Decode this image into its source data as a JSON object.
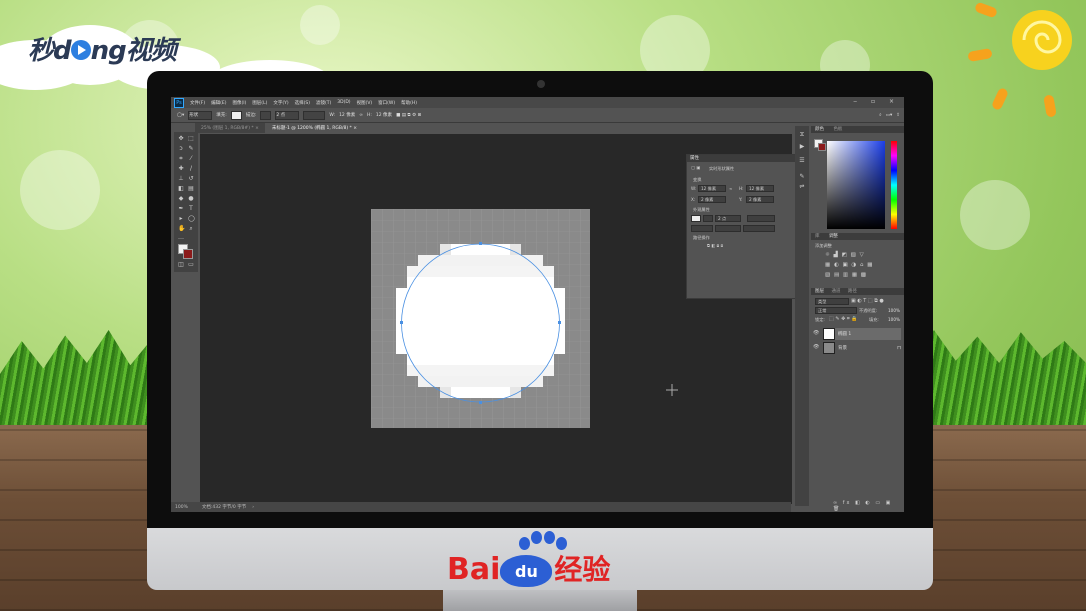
{
  "watermark": {
    "logo_prefix": "秒d",
    "logo_suffix": "ng视频"
  },
  "brand": {
    "baidu_left": "Bai",
    "baidu_du": "du",
    "baidu_right": "经验"
  },
  "photoshop": {
    "app_icon": "Ps",
    "menu": [
      "文件(F)",
      "编辑(E)",
      "图像(I)",
      "图层(L)",
      "文字(Y)",
      "选择(S)",
      "滤镜(T)",
      "3D(D)",
      "视图(V)",
      "窗口(W)",
      "帮助(H)"
    ],
    "window_controls": "‒ ▫ ×",
    "options_bar": {
      "tool_label": "形状",
      "fill_label": "填充:",
      "stroke_label": "描边:",
      "stroke_size": "2 点",
      "w_label": "W:",
      "w_value": "12 像素",
      "h_label": "H:",
      "h_value": "12 像素"
    },
    "tabs": [
      {
        "label": "25% (图层 1, RGB/8#) *",
        "active": false
      },
      {
        "label": "未标题-1 @ 1200% (椭圆 1, RGB/8) *",
        "active": true
      }
    ],
    "status": {
      "zoom": "100%",
      "doc_info": "文档:432 字节/0 字节"
    },
    "properties_panel": {
      "tab": "属性",
      "title": "实时形状属性",
      "section_transform": "变换",
      "w_label": "W:",
      "w_value": "12 像素",
      "h_label": "H:",
      "h_value": "12 像素",
      "x_label": "X:",
      "x_value": "2 像素",
      "y_label": "Y:",
      "y_value": "2 像素",
      "section_appearance": "外观属性",
      "stroke_value": "2 点",
      "section_path_ops": "路径操作"
    },
    "color_panel": {
      "tabs": [
        "颜色",
        "色板"
      ]
    },
    "adjust_panel": {
      "tabs": [
        "库",
        "调整"
      ],
      "title": "添加调整"
    },
    "layers_panel": {
      "tabs": [
        "图层",
        "通道",
        "路径"
      ],
      "filter": "类型",
      "blend_mode": "正常",
      "opacity_label": "不透明度:",
      "opacity_value": "100%",
      "lock_label": "锁定:",
      "fill_label": "填充:",
      "fill_value": "100%",
      "layers": [
        {
          "name": "椭圆 1",
          "selected": true
        },
        {
          "name": "背景",
          "selected": false
        }
      ]
    }
  },
  "colors": {
    "ps_bg": "#535353",
    "canvas_bg": "#282828",
    "baidu_red": "#e02424",
    "baidu_blue": "#2c5fd4"
  }
}
